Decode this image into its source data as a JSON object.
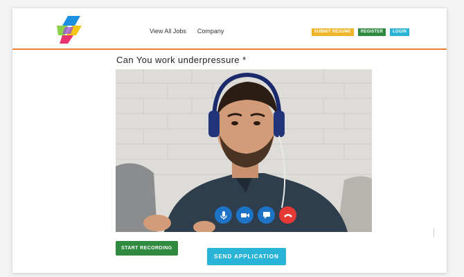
{
  "header": {
    "nav": [
      {
        "label": "View All Jobs"
      },
      {
        "label": "Company"
      }
    ],
    "actions": {
      "submit_resume": "SUBMIT RESUME",
      "register": "REGISTER",
      "login": "LOGIN"
    }
  },
  "question": {
    "text": "Can You work underpressure *"
  },
  "video": {
    "controls": [
      "microphone-icon",
      "video-camera-icon",
      "chat-icon",
      "hang-up-icon"
    ]
  },
  "buttons": {
    "start_recording": "START RECORDING",
    "send_application": "SEND APPLICATION"
  },
  "colors": {
    "accent_orange": "#f07f2f",
    "submit_yellow": "#f0b429",
    "register_green": "#2e8b3e",
    "login_cyan": "#29b3d6",
    "control_blue": "#1d74c7",
    "hangup_red": "#e53935"
  }
}
